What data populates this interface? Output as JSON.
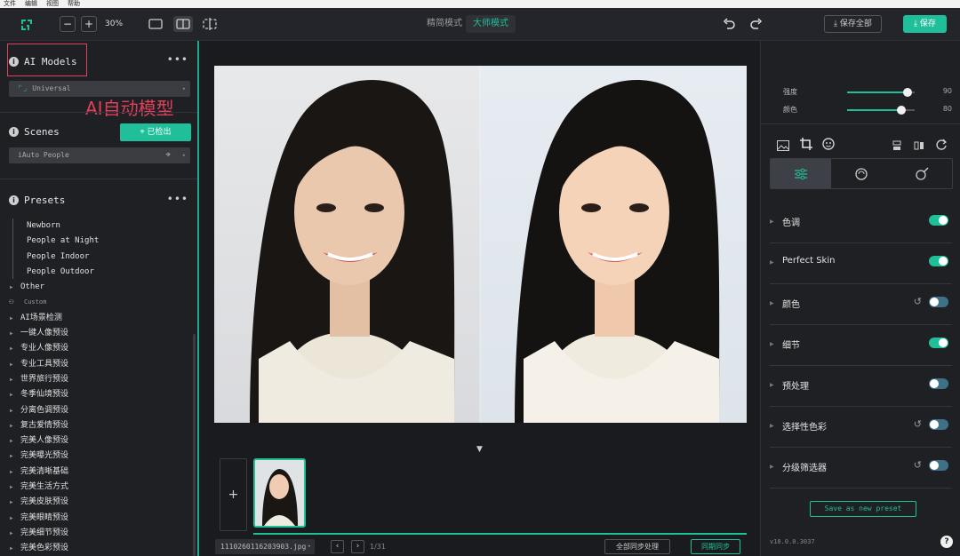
{
  "menu": [
    "文件",
    "编辑",
    "视图",
    "帮助"
  ],
  "toolbar": {
    "zoom_label": "30%",
    "minus_label": "−",
    "plus_label": "+",
    "mode_simple": "精简模式",
    "mode_master": "大师模式",
    "save_all_label": "保存全部",
    "save_label": "保存"
  },
  "left": {
    "ai_models_title": "AI Models",
    "model_selected": "Universal",
    "annotation": "AI自动模型",
    "scenes_title": "Scenes",
    "scenes_button": "已检出",
    "scene_selected": "iAuto People",
    "presets_title": "Presets",
    "preset_items": [
      {
        "label": "Newborn",
        "indent": 2,
        "arrow": false
      },
      {
        "label": "People at Night",
        "indent": 2,
        "arrow": false
      },
      {
        "label": "People Indoor",
        "indent": 2,
        "arrow": false
      },
      {
        "label": "People Outdoor",
        "indent": 2,
        "arrow": false
      },
      {
        "label": "Other",
        "indent": 1,
        "arrow": true
      },
      {
        "label": "Custom",
        "indent": 1,
        "arrow": false,
        "user": true
      },
      {
        "label": "AI场景检测",
        "indent": 1,
        "arrow": true
      },
      {
        "label": "一键人像预设",
        "indent": 1,
        "arrow": true
      },
      {
        "label": "专业人像预设",
        "indent": 1,
        "arrow": true
      },
      {
        "label": "专业工具预设",
        "indent": 1,
        "arrow": true
      },
      {
        "label": "世界旅行预设",
        "indent": 1,
        "arrow": true
      },
      {
        "label": "冬季仙境预设",
        "indent": 1,
        "arrow": true
      },
      {
        "label": "分离色调预设",
        "indent": 1,
        "arrow": true
      },
      {
        "label": "复古爱情预设",
        "indent": 1,
        "arrow": true
      },
      {
        "label": "完美人像预设",
        "indent": 1,
        "arrow": true
      },
      {
        "label": "完美曝光预设",
        "indent": 1,
        "arrow": true
      },
      {
        "label": "完美清晰基础",
        "indent": 1,
        "arrow": true
      },
      {
        "label": "完美生活方式",
        "indent": 1,
        "arrow": true
      },
      {
        "label": "完美皮肤预设",
        "indent": 1,
        "arrow": true
      },
      {
        "label": "完美眼睛预设",
        "indent": 1,
        "arrow": true
      },
      {
        "label": "完美细节预设",
        "indent": 1,
        "arrow": true
      },
      {
        "label": "完美色彩预设",
        "indent": 1,
        "arrow": true
      }
    ]
  },
  "bottom": {
    "filename": "1110260116203903.jpg",
    "page_count": "1/31",
    "sync_all": "全部同步处理",
    "sync": "同期同步"
  },
  "right": {
    "sliders": [
      {
        "label": "强度",
        "value": 90
      },
      {
        "label": "颜色",
        "value": 80
      }
    ],
    "adjustments": [
      {
        "label": "色调",
        "on": true,
        "reset": false
      },
      {
        "label": "Perfect Skin",
        "on": true,
        "reset": false
      },
      {
        "label": "颜色",
        "on": false,
        "reset": true
      },
      {
        "label": "细节",
        "on": true,
        "reset": false
      },
      {
        "label": "预处理",
        "on": false,
        "reset": false
      },
      {
        "label": "选择性色彩",
        "on": false,
        "reset": true
      },
      {
        "label": "分级筛选器",
        "on": false,
        "reset": true
      }
    ],
    "save_preset": "Save as new preset",
    "version": "v18.0.0.3037",
    "help": "?"
  },
  "colors": {
    "accent": "#1fbf9a",
    "panel": "#1f2024",
    "annotation": "#e0405a"
  }
}
